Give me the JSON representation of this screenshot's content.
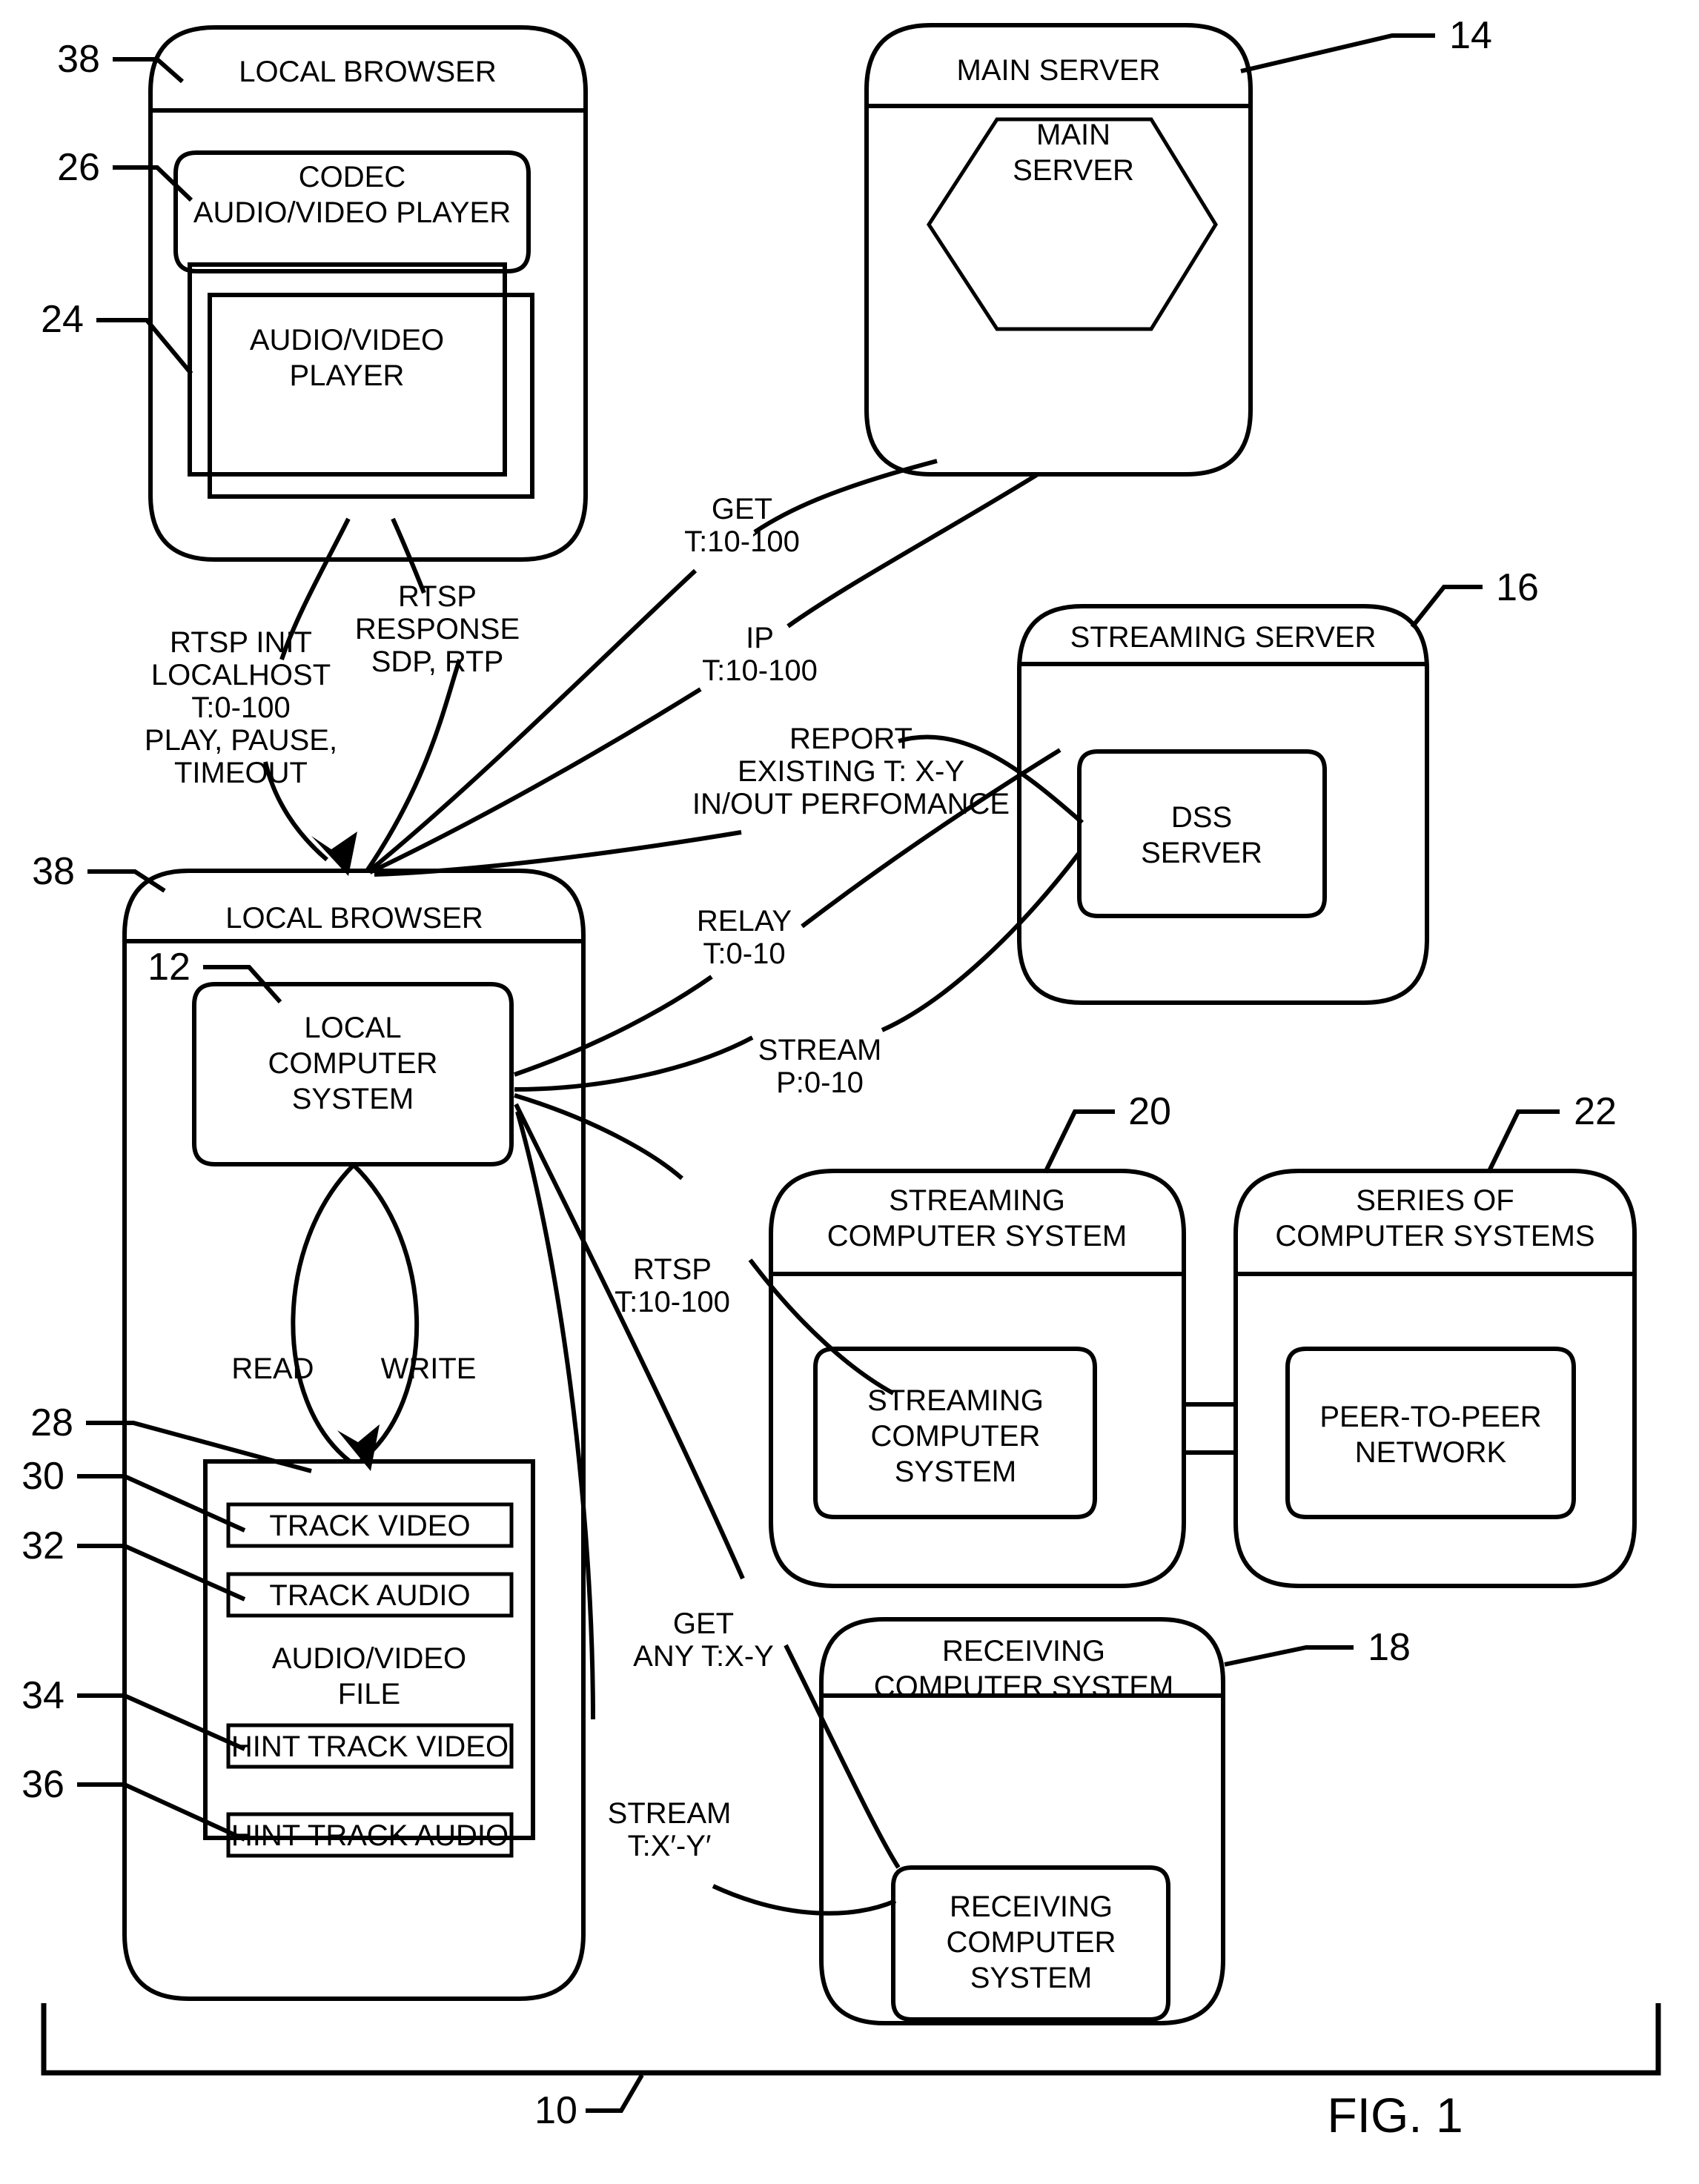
{
  "figure": {
    "caption": "FIG. 1",
    "system_ref": "10"
  },
  "nodes": {
    "local_browser_top": {
      "title": "LOCAL BROWSER",
      "ref": "38",
      "children": {
        "codec": {
          "line1": "CODEC",
          "line2": "AUDIO/VIDEO PLAYER",
          "ref": "26"
        },
        "player": {
          "line1": "AUDIO/VIDEO",
          "line2": "PLAYER",
          "ref": "24"
        }
      }
    },
    "main_server": {
      "title": "MAIN SERVER",
      "ref": "14",
      "inner": {
        "line1": "MAIN",
        "line2": "SERVER"
      }
    },
    "streaming_server": {
      "title": "STREAMING SERVER",
      "ref": "16",
      "inner": {
        "line1": "DSS",
        "line2": "SERVER"
      }
    },
    "local_browser_bottom": {
      "title": "LOCAL BROWSER",
      "ref": "38",
      "local_computer_system": {
        "ref": "12",
        "line1": "LOCAL",
        "line2": "COMPUTER",
        "line3": "SYSTEM"
      },
      "read_label": "READ",
      "write_label": "WRITE",
      "av_file": {
        "ref": "28",
        "line1": "AUDIO/VIDEO",
        "line2": "FILE",
        "tracks": [
          {
            "label": "TRACK VIDEO",
            "ref": "30"
          },
          {
            "label": "TRACK AUDIO",
            "ref": "32"
          },
          {
            "label": "HINT TRACK VIDEO",
            "ref": "34"
          },
          {
            "label": "HINT TRACK AUDIO",
            "ref": "36"
          }
        ]
      }
    },
    "streaming_computer_system": {
      "title_line1": "STREAMING",
      "title_line2": "COMPUTER SYSTEM",
      "ref": "20",
      "inner": {
        "line1": "STREAMING",
        "line2": "COMPUTER",
        "line3": "SYSTEM"
      }
    },
    "series_of_computer_systems": {
      "title_line1": "SERIES OF",
      "title_line2": "COMPUTER SYSTEMS",
      "ref": "22",
      "inner": {
        "line1": "PEER-TO-PEER",
        "line2": "NETWORK"
      }
    },
    "receiving_computer_system": {
      "title_line1": "RECEIVING",
      "title_line2": "COMPUTER SYSTEM",
      "ref": "18",
      "inner": {
        "line1": "RECEIVING",
        "line2": "COMPUTER",
        "line3": "SYSTEM"
      }
    }
  },
  "flow_labels": {
    "rtsp_init": {
      "l1": "RTSP INIT",
      "l2": "LOCALHOST",
      "l3": "T:0-100",
      "l4": "PLAY, PAUSE,",
      "l5": "TIMEOUT"
    },
    "rtsp_response": {
      "l1": "RTSP",
      "l2": "RESPONSE",
      "l3": "SDP, RTP"
    },
    "get_t10_100": {
      "l1": "GET",
      "l2": "T:10-100"
    },
    "ip_t10_100": {
      "l1": "IP",
      "l2": "T:10-100"
    },
    "report": {
      "l1": "REPORT",
      "l2": "EXISTING T: X-Y",
      "l3": "IN/OUT PERFOMANCE"
    },
    "relay": {
      "l1": "RELAY",
      "l2": "T:0-10"
    },
    "stream_p": {
      "l1": "STREAM",
      "l2": "P:0-10"
    },
    "rtsp_t": {
      "l1": "RTSP",
      "l2": "T:10-100"
    },
    "get_any": {
      "l1": "GET",
      "l2": "ANY T:X-Y"
    },
    "stream_txy": {
      "l1": "STREAM",
      "l2": "T:X′-Y′"
    }
  },
  "colors": {
    "ink": "#000000",
    "paper": "#ffffff"
  }
}
